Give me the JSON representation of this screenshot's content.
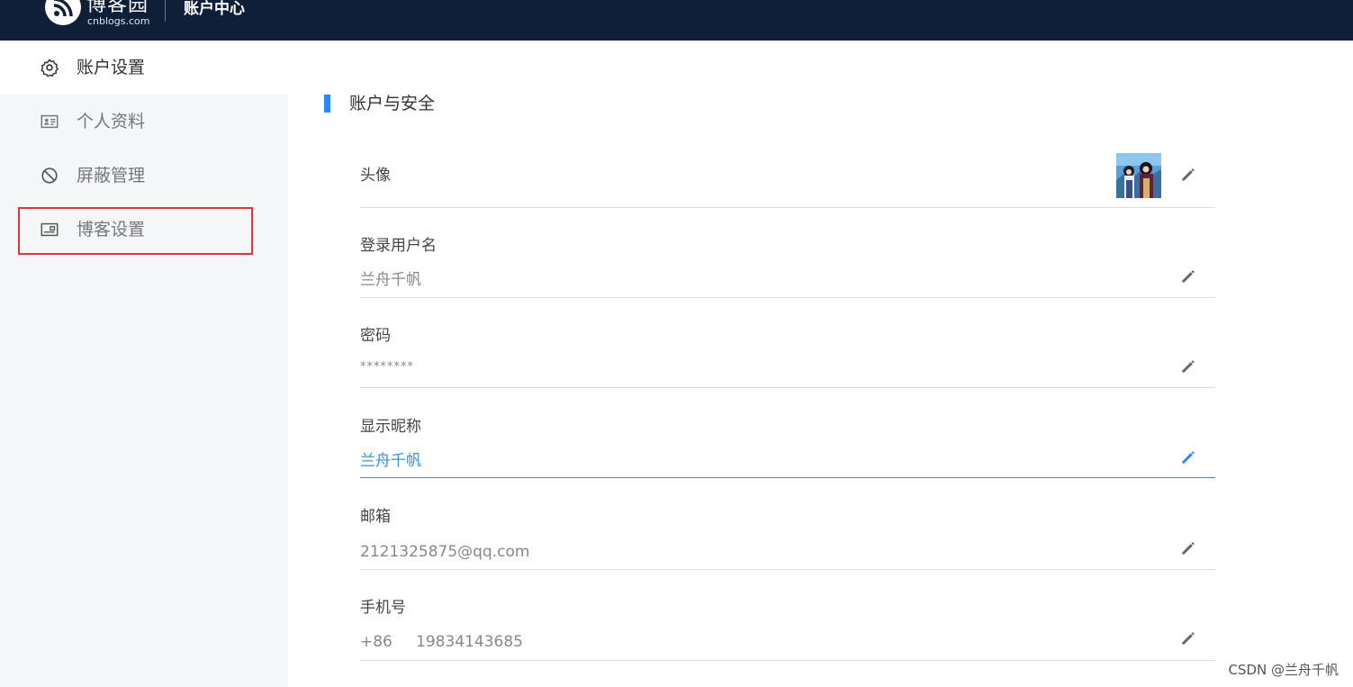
{
  "header": {
    "brand_name": "博客园",
    "brand_domain": "cnblogs.com",
    "title": "账户中心",
    "logo_icon": "rss-feed-icon",
    "background_color": "#0f1f38"
  },
  "sidebar": {
    "items": [
      {
        "label": "账户设置",
        "icon": "gear-icon",
        "active": true
      },
      {
        "label": "个人资料",
        "icon": "id-card-icon",
        "active": false
      },
      {
        "label": "屏蔽管理",
        "icon": "block-icon",
        "active": false
      },
      {
        "label": "博客设置",
        "icon": "blog-card-icon",
        "active": false,
        "highlighted": true
      }
    ]
  },
  "main": {
    "section_title": "账户与安全",
    "accent_color": "#2f86f6",
    "fields": {
      "avatar": {
        "label": "头像"
      },
      "username": {
        "label": "登录用户名",
        "value": "兰舟千帆"
      },
      "password": {
        "label": "密码",
        "value": "********"
      },
      "nickname": {
        "label": "显示昵称",
        "value": "兰舟千帆",
        "focused": true
      },
      "email": {
        "label": "邮箱",
        "value": "2121325875@qq.com"
      },
      "phone": {
        "label": "手机号",
        "code": "+86",
        "number": "19834143685"
      }
    },
    "edit_icon": "pencil-icon"
  },
  "watermark": "CSDN @兰舟千帆"
}
